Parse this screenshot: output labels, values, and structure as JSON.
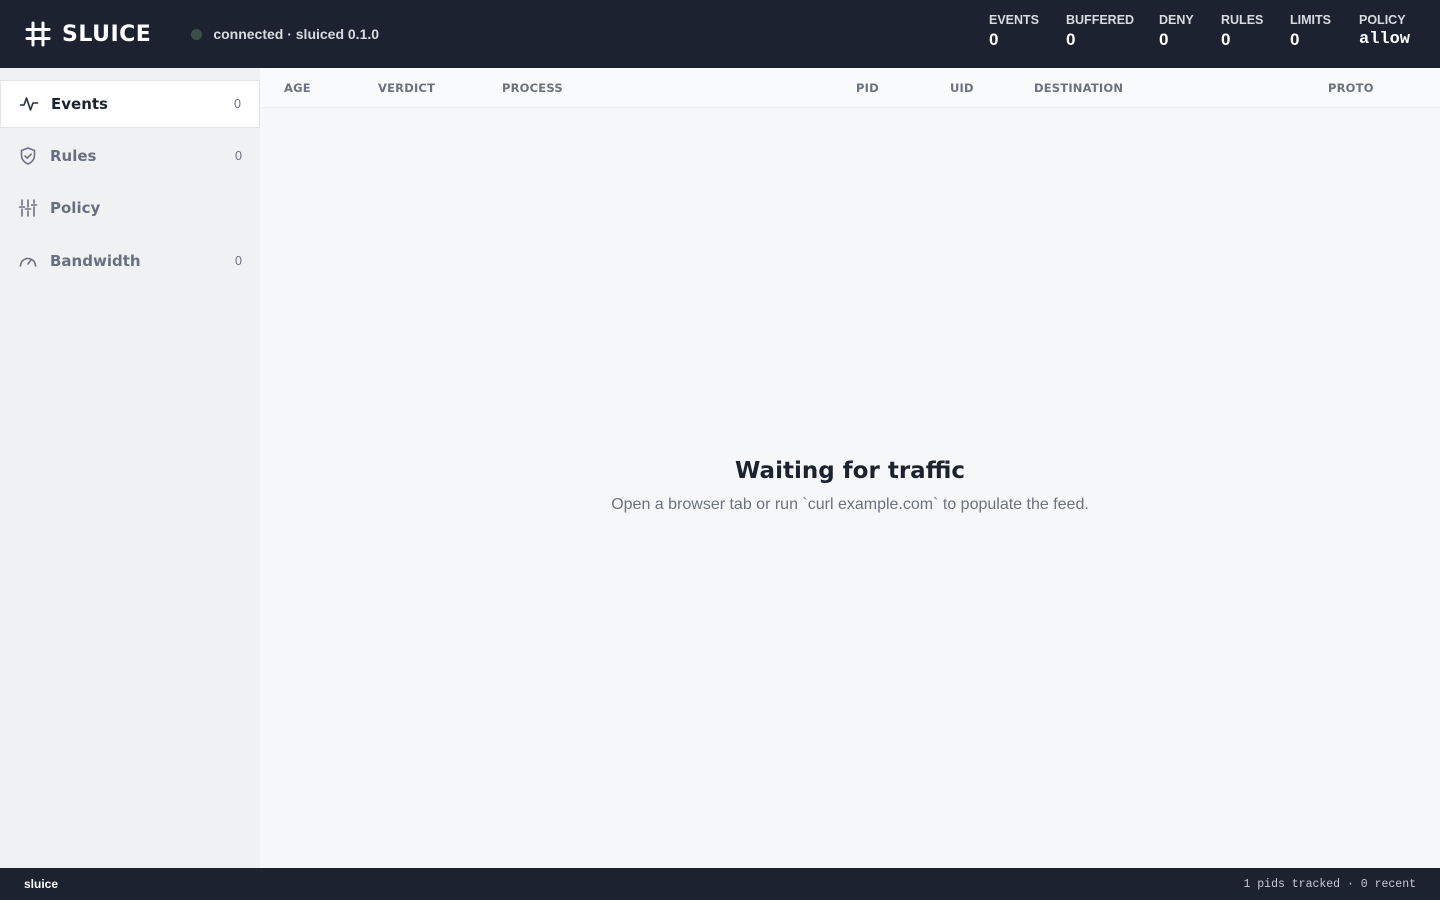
{
  "header": {
    "app_name": "SLUICE",
    "logo_icon": "hash-icon",
    "status_color": "#3b5148",
    "status_text": "connected · sluiced 0.1.0",
    "stats": [
      {
        "label": "EVENTS",
        "value": "0"
      },
      {
        "label": "BUFFERED",
        "value": "0"
      },
      {
        "label": "DENY",
        "value": "0"
      },
      {
        "label": "RULES",
        "value": "0"
      },
      {
        "label": "LIMITS",
        "value": "0"
      },
      {
        "label": "POLICY",
        "value": "allow"
      }
    ]
  },
  "sidebar": {
    "items": [
      {
        "label": "Events",
        "count": "0",
        "icon": "activity-icon",
        "active": true
      },
      {
        "label": "Rules",
        "count": "0",
        "icon": "shield-check-icon",
        "active": false
      },
      {
        "label": "Policy",
        "count": "",
        "icon": "sliders-icon",
        "active": false
      },
      {
        "label": "Bandwidth",
        "count": "0",
        "icon": "gauge-icon",
        "active": false
      }
    ]
  },
  "table": {
    "columns": [
      "AGE",
      "VERDICT",
      "PROCESS",
      "PID",
      "UID",
      "DESTINATION",
      "PROTO"
    ]
  },
  "empty_state": {
    "title": "Waiting for traffic",
    "subtitle": "Open a browser tab or run `curl example.com` to populate the feed."
  },
  "footer": {
    "left": "sluice",
    "right": "1 pids tracked · 0 recent"
  }
}
